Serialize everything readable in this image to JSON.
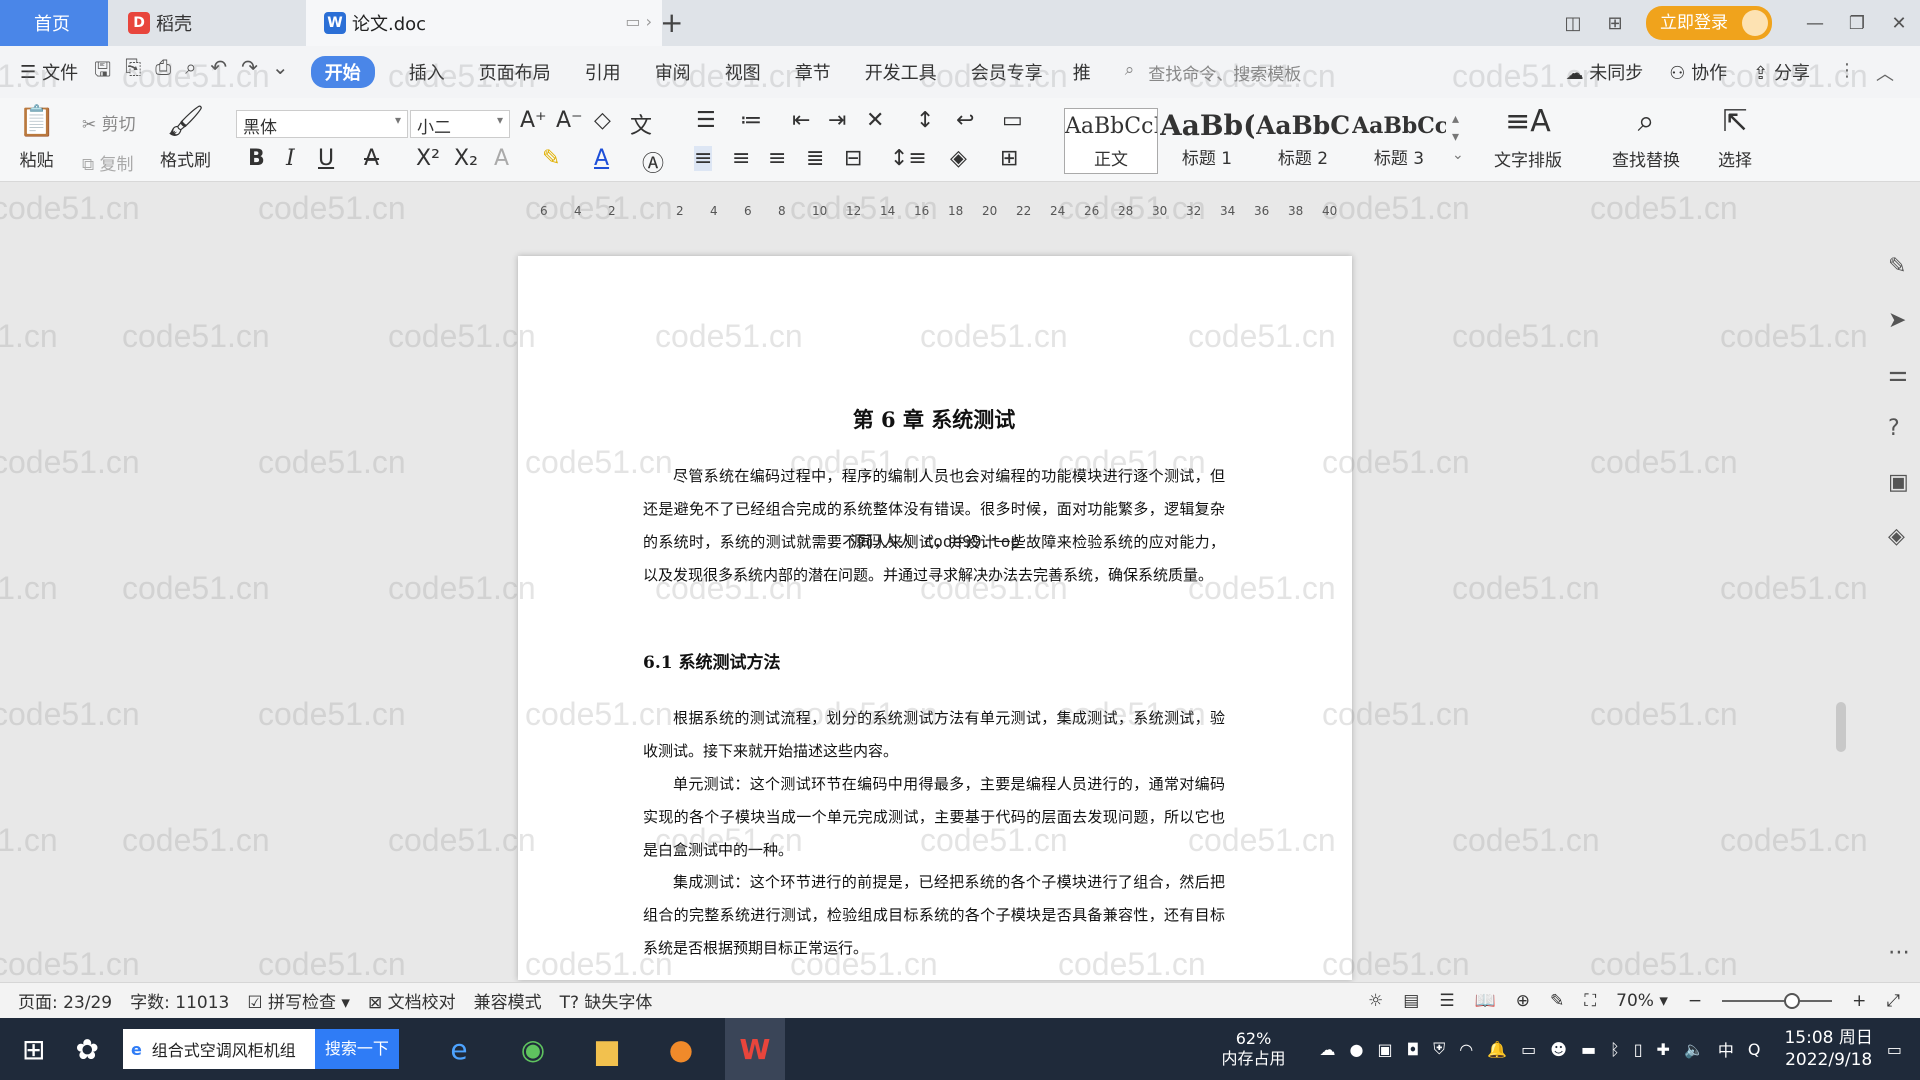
{
  "tabs": {
    "home": "首页",
    "daoke": "稻壳",
    "doc": "论文.doc",
    "login": "立即登录"
  },
  "menu": {
    "file": "文件",
    "tabs": [
      "开始",
      "插入",
      "页面布局",
      "引用",
      "审阅",
      "视图",
      "章节",
      "开发工具",
      "会员专享",
      "推"
    ],
    "search_cmd": "查找命令、搜索模板",
    "unsynced": "未同步",
    "collab": "协作",
    "share": "分享"
  },
  "ribbon": {
    "paste": "粘贴",
    "cut": "剪切",
    "copy": "复制",
    "format_painter": "格式刷",
    "font_name": "黑体",
    "font_size": "小二",
    "styles": [
      {
        "preview": "AaBbCcI",
        "label": "正文"
      },
      {
        "preview": "AaBb(",
        "label": "标题 1"
      },
      {
        "preview": "AaBbC",
        "label": "标题 2"
      },
      {
        "preview": "AaBbCcl",
        "label": "标题 3"
      }
    ],
    "text_layout": "文字排版",
    "find_replace": "查找替换",
    "select": "选择"
  },
  "ruler_ticks": [
    "6",
    "4",
    "2",
    "",
    "2",
    "4",
    "6",
    "8",
    "10",
    "12",
    "14",
    "16",
    "18",
    "20",
    "22",
    "24",
    "26",
    "28",
    "30",
    "32",
    "34",
    "36",
    "38",
    "40"
  ],
  "document": {
    "chapter_title": "第 6 章  系统测试",
    "p1": "尽管系统在编码过程中，程序的编制人员也会对编程的功能模块进行逐个测试，但还是避免不了已经组合完成的系统整体没有错误。很多时候，面对功能繁多，逻辑复杂的系统时，系统的测试就需要不同人来测试，并设计一些故障来检验系统的应对能力，以及发现很多系统内部的潜在问题。并通过寻求解决办法去完善系统，确保系统质量。",
    "page_mark": "源码人人 code99.top",
    "section_title": "6.1  系统测试方法",
    "p2": "根据系统的测试流程，划分的系统测试方法有单元测试，集成测试，系统测试，验收测试。接下来就开始描述这些内容。",
    "p3": "单元测试：这个测试环节在编码中用得最多，主要是编程人员进行的，通常对编码实现的各个子模块当成一个单元完成测试，主要基于代码的层面去发现问题，所以它也是白盒测试中的一种。",
    "p4": "集成测试：这个环节进行的前提是，已经把系统的各个子模块进行了组合，然后把组合的完整系统进行测试，检验组成目标系统的各个子模块是否具备兼容性，还有目标系统是否根据预期目标正常运行。"
  },
  "watermark": "code51.cn",
  "status": {
    "page": "页面: 23/29",
    "words": "字数: 11013",
    "spell": "拼写检查",
    "proof": "文档校对",
    "compat": "兼容模式",
    "missing_font": "缺失字体",
    "zoom": "70%"
  },
  "taskbar": {
    "search_text": "组合式空调风柜机组",
    "search_btn": "搜索一下",
    "mem_pct": "62%",
    "mem_label": "内存占用",
    "ime": "中",
    "time": "15:08 周日",
    "date": "2022/9/18"
  }
}
